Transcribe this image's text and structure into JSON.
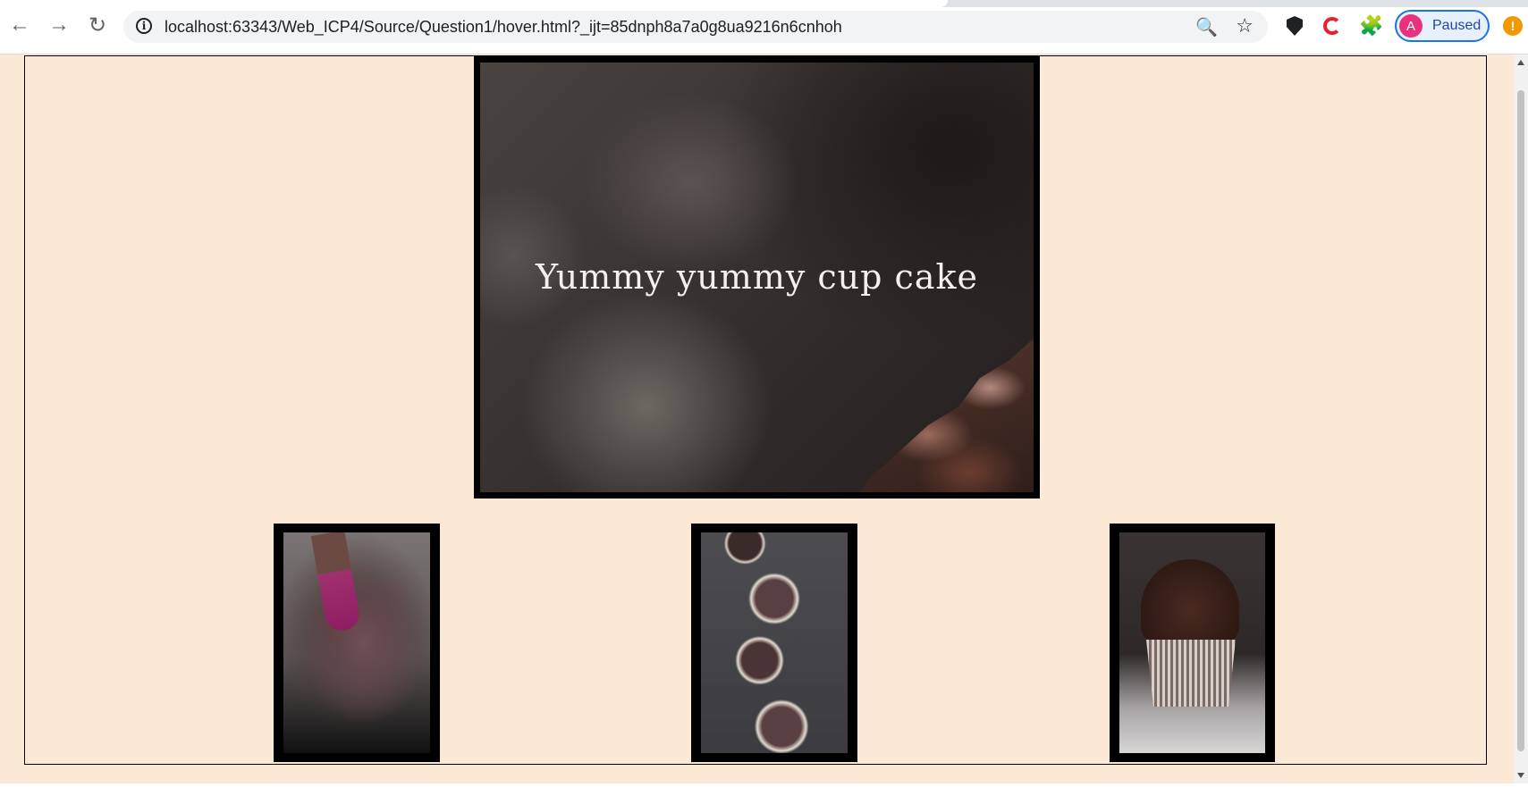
{
  "browser": {
    "url": "localhost:63343/Web_ICP4/Source/Question1/hover.html?_ijt=85dnph8a7a0g8ua9216n6cnhoh",
    "back_icon": "←",
    "forward_icon": "→",
    "reload_icon": "↻",
    "info_icon": "i",
    "zoom_icon": "🔍",
    "star_icon": "☆",
    "puzzle_icon": "🧩",
    "profile": {
      "avatar_letter": "A",
      "status": "Paused"
    },
    "menu_alert": "!"
  },
  "page": {
    "hero": {
      "caption": "Yummy yummy cup cake"
    },
    "thumbnails": [
      {
        "name": "chocolate-batter-bowl-image"
      },
      {
        "name": "cupcake-pan-image"
      },
      {
        "name": "frosted-cupcake-image"
      }
    ]
  }
}
